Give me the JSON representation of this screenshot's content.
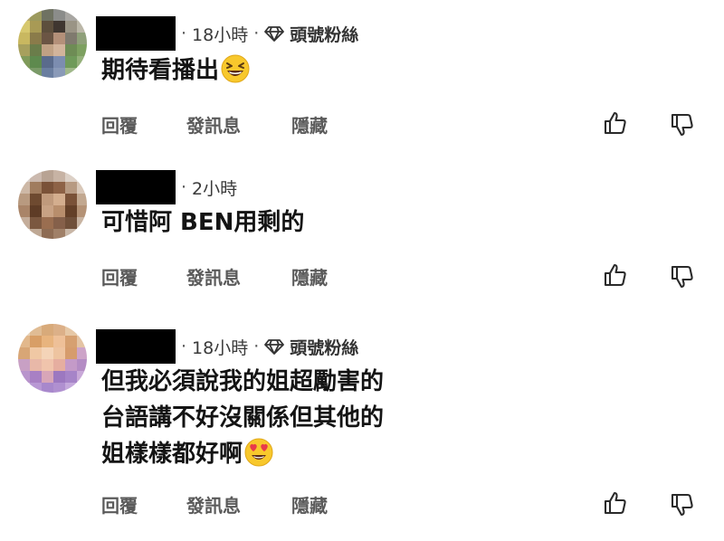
{
  "comments": [
    {
      "time": "18小時",
      "badge": "頭號粉絲",
      "lines": [
        "期待看播出"
      ],
      "emoji": "grinning-squint-emoji",
      "actions": {
        "reply": "回覆",
        "message": "發訊息",
        "hide": "隱藏"
      }
    },
    {
      "time": "2小時",
      "badge": "",
      "lines": [
        "可惜阿 BEN用剩的"
      ],
      "actions": {
        "reply": "回覆",
        "message": "發訊息",
        "hide": "隱藏"
      }
    },
    {
      "time": "18小時",
      "badge": "頭號粉絲",
      "lines": [
        "但我必須說我的姐超勵害的",
        "台語講不好沒關係但其他的",
        "姐樣樣都好啊"
      ],
      "emoji": "heart-eyes-emoji",
      "actions": {
        "reply": "回覆",
        "message": "發訊息",
        "hide": "隱藏"
      }
    }
  ],
  "icons": {
    "like": "thumbs-up-icon",
    "dislike": "thumbs-down-icon",
    "badge": "diamond-icon"
  },
  "colors": {
    "text": "#141414",
    "secondary": "#5a5a5a",
    "censor": "#000000"
  }
}
